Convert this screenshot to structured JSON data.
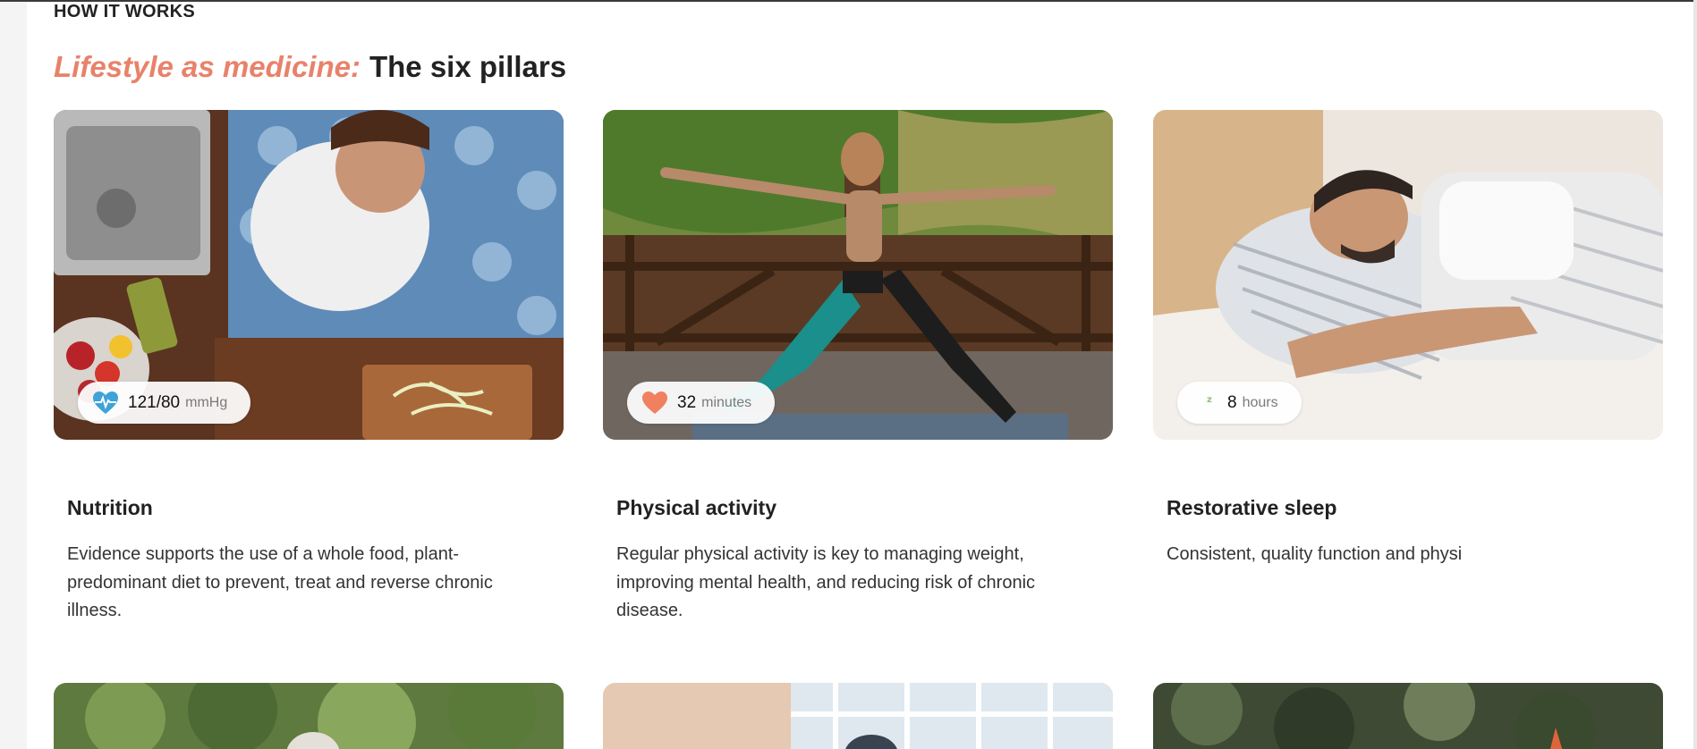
{
  "section": {
    "eyebrow": "HOW IT WORKS",
    "headline_accent": "Lifestyle as medicine:",
    "headline_rest": "The six pillars"
  },
  "cards": [
    {
      "title": "Nutrition",
      "description": "Evidence supports the use of a whole food, plant-predominant diet to prevent, treat and reverse chronic illness.",
      "metric_value": "121/80",
      "metric_unit": "mmHg",
      "metric_icon": "heart-pulse-icon"
    },
    {
      "title": "Physical activity",
      "description": "Regular physical activity is key to managing weight, improving mental health, and reducing risk of chronic disease.",
      "metric_value": "32",
      "metric_unit": "minutes",
      "metric_icon": "heart-icon"
    },
    {
      "title": "Restorative sleep",
      "description": "Consistent, quality function and physi",
      "metric_value": "8",
      "metric_unit": "hours",
      "metric_icon": "moon-sleep-icon"
    }
  ],
  "colors": {
    "accent": "#e8826a",
    "text": "#222222"
  }
}
